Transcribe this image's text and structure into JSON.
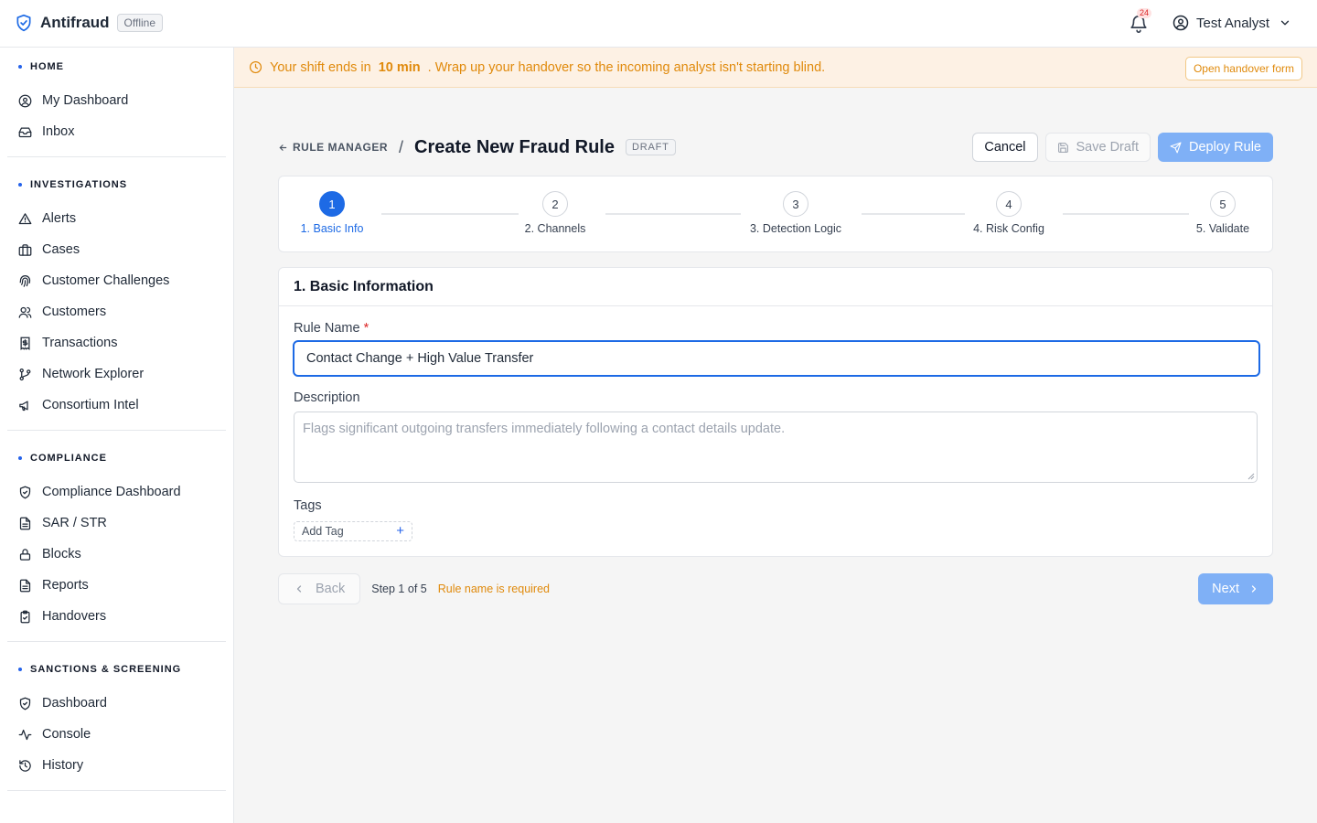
{
  "app": {
    "name": "Antifraud",
    "status": "Offline",
    "notifications_count": "24",
    "user_name": "Test Analyst"
  },
  "sidebar": {
    "sections": [
      {
        "title": "HOME",
        "items": [
          "My Dashboard",
          "Inbox"
        ]
      },
      {
        "title": "INVESTIGATIONS",
        "items": [
          "Alerts",
          "Cases",
          "Customer Challenges",
          "Customers",
          "Transactions",
          "Network Explorer",
          "Consortium Intel"
        ]
      },
      {
        "title": "COMPLIANCE",
        "items": [
          "Compliance Dashboard",
          "SAR / STR",
          "Blocks",
          "Reports",
          "Handovers"
        ]
      },
      {
        "title": "SANCTIONS & SCREENING",
        "items": [
          "Dashboard",
          "Console",
          "History"
        ]
      }
    ]
  },
  "banner": {
    "prefix": "Your shift ends in",
    "time": "10 min",
    "suffix": ". Wrap up your handover so the incoming analyst isn't starting blind.",
    "button": "Open handover form"
  },
  "header": {
    "breadcrumb": "RULE MANAGER",
    "separator": "/",
    "title": "Create New Fraud Rule",
    "badge": "DRAFT",
    "cancel": "Cancel",
    "save_draft": "Save Draft",
    "deploy": "Deploy Rule"
  },
  "stepper": {
    "steps": [
      {
        "number": "1",
        "label": "1. Basic Info",
        "active": true
      },
      {
        "number": "2",
        "label": "2. Channels",
        "active": false
      },
      {
        "number": "3",
        "label": "3. Detection Logic",
        "active": false
      },
      {
        "number": "4",
        "label": "4. Risk Config",
        "active": false
      },
      {
        "number": "5",
        "label": "5. Validate",
        "active": false
      }
    ]
  },
  "form": {
    "title": "1. Basic Information",
    "rule_name_label": "Rule Name",
    "required_mark": "*",
    "rule_name_value": "Contact Change + High Value Transfer",
    "description_label": "Description",
    "description_placeholder": "Flags significant outgoing transfers immediately following a contact details update.",
    "tags_label": "Tags",
    "add_tag_placeholder": "Add Tag",
    "add_tag_symbol": "+"
  },
  "footer": {
    "back": "Back",
    "step_info": "Step 1 of 5",
    "error": "Rule name is required",
    "next": "Next"
  },
  "colors": {
    "primary": "#1d6ae5",
    "primary_disabled": "#7fb0f6",
    "warning": "#e08a0c",
    "warning_bg": "#fdf1e4",
    "required": "#dc2626"
  }
}
